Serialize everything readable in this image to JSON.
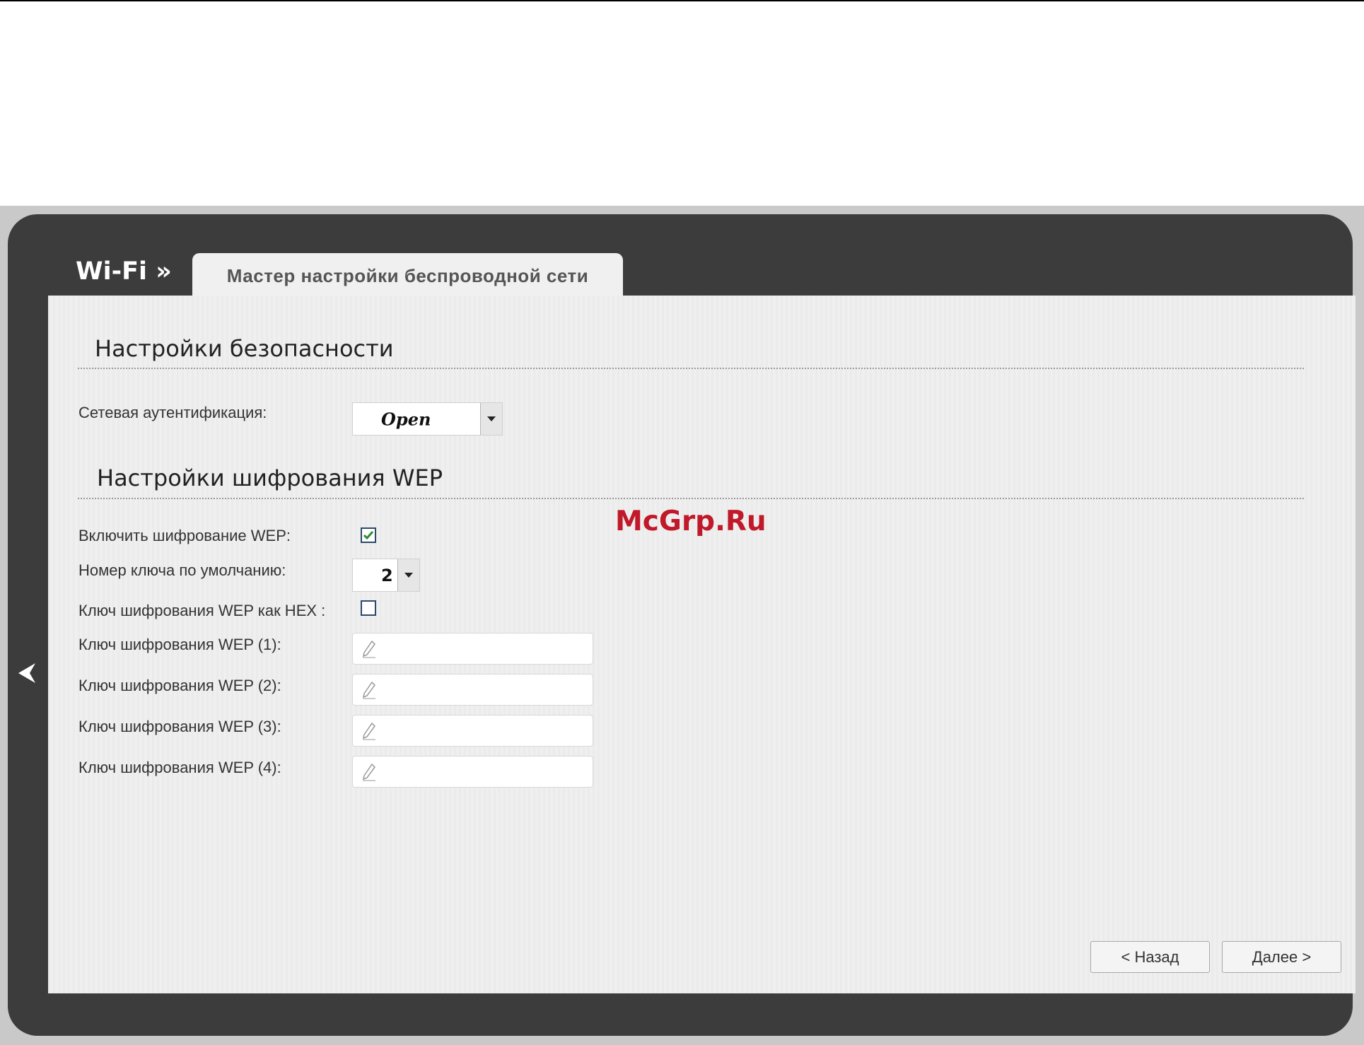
{
  "header": {
    "brand": "Wi-Fi »",
    "tab_label": "Мастер настройки беспроводной сети"
  },
  "security": {
    "title": "Настройки безопасности",
    "auth_label": "Сетевая аутентификация:",
    "auth_value": "Open"
  },
  "wep": {
    "title": "Настройки шифрования WEP",
    "enable_label": "Включить шифрование WEP:",
    "enable_checked": true,
    "default_key_label": "Номер ключа по умолчанию:",
    "default_key_value": "2",
    "hex_label": "Ключ шифрования WEP как HEX :",
    "hex_checked": false,
    "keys": [
      {
        "label": "Ключ шифрования WEP (1):",
        "value": ""
      },
      {
        "label": "Ключ шифрования WEP (2):",
        "value": ""
      },
      {
        "label": "Ключ шифрования WEP (3):",
        "value": ""
      },
      {
        "label": "Ключ шифрования WEP (4):",
        "value": ""
      }
    ]
  },
  "watermark": "McGrp.Ru",
  "buttons": {
    "back": "< Назад",
    "next": "Далее >"
  },
  "icons": {
    "nav_back": "chevron-left-icon",
    "field_edit": "pencil-icon",
    "dropdown": "triangle-down-icon"
  },
  "colors": {
    "frame": "#3c3c3c",
    "panel": "#efefef",
    "checkmark": "#2e8b2e",
    "watermark": "#c0192a"
  }
}
